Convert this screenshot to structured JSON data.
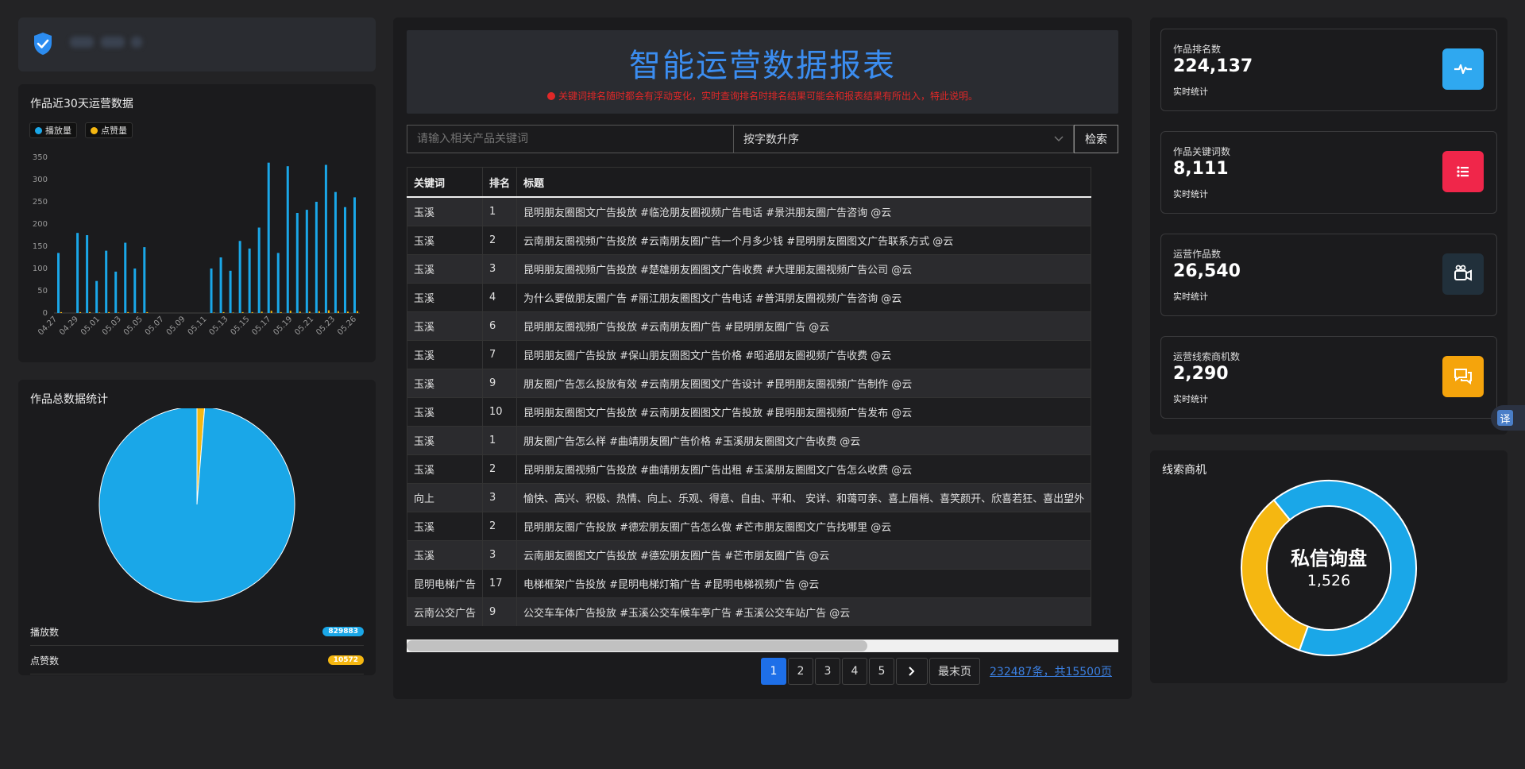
{
  "colors": {
    "play": "#1aa7e8",
    "like": "#f5b711",
    "accent": "#1e6fe8",
    "notice": "#e02828"
  },
  "brand": {
    "icon": "shield-check-icon"
  },
  "daily": {
    "title": "作品近30天运营数据",
    "legend": [
      "播放量",
      "点赞量"
    ]
  },
  "totals": {
    "title": "作品总数据统计",
    "rows": [
      {
        "label": "播放数",
        "value": "829883"
      },
      {
        "label": "点赞数",
        "value": "10572"
      }
    ]
  },
  "chart_data": [
    {
      "type": "bar",
      "series": [
        {
          "name": "播放量",
          "values": [
            135,
            null,
            180,
            175,
            72,
            140,
            93,
            158,
            100,
            148,
            null,
            null,
            null,
            null,
            null,
            null,
            100,
            125,
            95,
            162,
            145,
            192,
            338,
            135,
            330,
            225,
            232,
            250,
            333,
            272,
            238,
            260
          ]
        },
        {
          "name": "点赞量",
          "values": [
            2,
            null,
            2,
            2,
            1,
            2,
            1,
            2,
            1,
            2,
            null,
            null,
            null,
            null,
            null,
            null,
            1,
            2,
            1,
            2,
            2,
            3,
            5,
            2,
            5,
            3,
            3,
            4,
            6,
            4,
            3,
            4
          ]
        }
      ],
      "x_ticks": [
        "04.27",
        "04.29",
        "05.01",
        "05.03",
        "05.05",
        "05.07",
        "05.09",
        "05.11",
        "05.13",
        "05.15",
        "05.17",
        "05.19",
        "05.21",
        "05.23",
        "05.26"
      ],
      "yticks": [
        0,
        50,
        100,
        150,
        200,
        250,
        300,
        350
      ],
      "ylim": [
        0,
        350
      ],
      "grid": false,
      "legend": "top-left"
    },
    {
      "type": "pie",
      "labels": [
        "播放数",
        "点赞数"
      ],
      "values": [
        829883,
        10572
      ],
      "legend": "none"
    },
    {
      "type": "pie",
      "labels": [
        "私信询盘"
      ],
      "values": [
        1526,
        776
      ],
      "title": "私信询盘",
      "center_value": "1,526",
      "legend": "none"
    }
  ],
  "center": {
    "title": "智能运营数据报表",
    "notice": "关键词排名随时都会有浮动变化，实时查询排名时排名结果可能会和报表结果有所出入，特此说明。",
    "search": {
      "placeholder": "请输入相关产品关键词",
      "sort": "按字数升序",
      "button": "检索"
    },
    "columns": [
      "关键词",
      "排名",
      "标题"
    ],
    "rows": [
      [
        "玉溪",
        "1",
        "昆明朋友圈图文广告投放 #临沧朋友圈视频广告电话 #景洪朋友圈广告咨询 @云"
      ],
      [
        "玉溪",
        "2",
        "云南朋友圈视频广告投放 #云南朋友圈广告一个月多少钱 #昆明朋友圈图文广告联系方式 @云"
      ],
      [
        "玉溪",
        "3",
        "昆明朋友圈视频广告投放 #楚雄朋友圈图文广告收费 #大理朋友圈视频广告公司 @云"
      ],
      [
        "玉溪",
        "4",
        "为什么要做朋友圈广告 #丽江朋友圈图文广告电话 #普洱朋友圈视频广告咨询 @云"
      ],
      [
        "玉溪",
        "6",
        "昆明朋友圈视频广告投放 #云南朋友圈广告 #昆明朋友圈广告 @云"
      ],
      [
        "玉溪",
        "7",
        "昆明朋友圈广告投放 #保山朋友圈图文广告价格 #昭通朋友圈视频广告收费 @云"
      ],
      [
        "玉溪",
        "9",
        "朋友圈广告怎么投放有效 #云南朋友圈图文广告设计 #昆明朋友圈视频广告制作 @云"
      ],
      [
        "玉溪",
        "10",
        "昆明朋友圈图文广告投放 #云南朋友圈图文广告投放 #昆明朋友圈视频广告发布 @云"
      ],
      [
        "玉溪",
        "1",
        "朋友圈广告怎么样 #曲靖朋友圈广告价格 #玉溪朋友圈图文广告收费 @云"
      ],
      [
        "玉溪",
        "2",
        "昆明朋友圈视频广告投放 #曲靖朋友圈广告出租 #玉溪朋友圈图文广告怎么收费 @云"
      ],
      [
        "向上",
        "3",
        "愉快、高兴、积极、热情、向上、乐观、得意、自由、平和、 安详、和蔼可亲、喜上眉梢、喜笑颜开、欣喜若狂、喜出望外"
      ],
      [
        "玉溪",
        "2",
        "昆明朋友圈广告投放 #德宏朋友圈广告怎么做 #芒市朋友圈图文广告找哪里 @云"
      ],
      [
        "玉溪",
        "3",
        "云南朋友圈图文广告投放 #德宏朋友圈广告 #芒市朋友圈广告 @云"
      ],
      [
        "昆明电梯广告",
        "17",
        "电梯框架广告投放 #昆明电梯灯箱广告 #昆明电梯视频广告 @云"
      ],
      [
        "云南公交广告",
        "9",
        "公交车车体广告投放 #玉溪公交车候车亭广告 #玉溪公交车站广告 @云"
      ]
    ],
    "pager": {
      "pages": [
        "1",
        "2",
        "3",
        "4",
        "5"
      ],
      "current": "1",
      "next_icon": "chevron-right-icon",
      "last": "最末页",
      "total": "232487条，共15500页"
    }
  },
  "stats": [
    {
      "label": "作品排名数",
      "value": "224,137",
      "sub": "实时统计",
      "icon": "pulse-icon",
      "color": "#2fa8f0"
    },
    {
      "label": "作品关键词数",
      "value": "8,111",
      "sub": "实时统计",
      "icon": "list-icon",
      "color": "#f0264a"
    },
    {
      "label": "运营作品数",
      "value": "26,540",
      "sub": "实时统计",
      "icon": "video-camera-icon",
      "color": "#21303b"
    },
    {
      "label": "运营线索商机数",
      "value": "2,290",
      "sub": "实时统计",
      "icon": "chat-icon",
      "color": "#f5a40c"
    }
  ],
  "leads": {
    "title": "线索商机"
  },
  "translate": {
    "label": "译"
  }
}
